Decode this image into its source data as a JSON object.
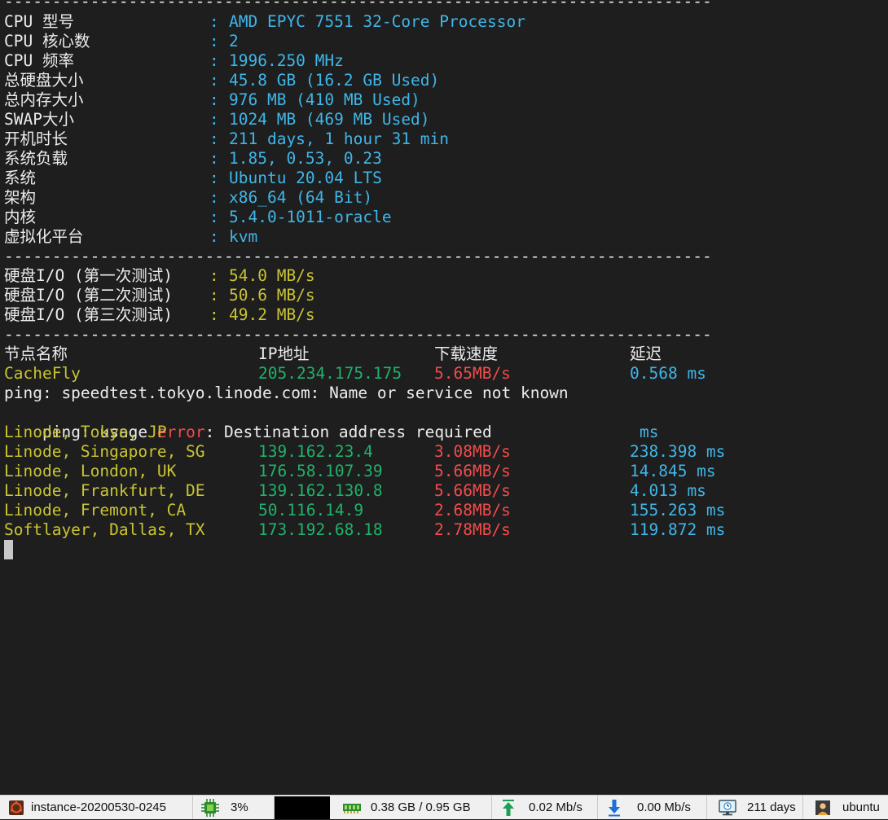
{
  "separator": "--------------------------------------------------------------------------",
  "sysinfo": [
    {
      "label": "CPU 型号",
      "value": "AMD EPYC 7551 32-Core Processor"
    },
    {
      "label": "CPU 核心数",
      "value": "2"
    },
    {
      "label": "CPU 频率",
      "value": "1996.250 MHz"
    },
    {
      "label": "总硬盘大小",
      "value": "45.8 GB (16.2 GB Used)"
    },
    {
      "label": "总内存大小",
      "value": "976 MB (410 MB Used)"
    },
    {
      "label": "SWAP大小",
      "value": "1024 MB (469 MB Used)"
    },
    {
      "label": "开机时长",
      "value": "211 days, 1 hour 31 min"
    },
    {
      "label": "系统负载",
      "value": "1.85, 0.53, 0.23"
    },
    {
      "label": "系统",
      "value": "Ubuntu 20.04 LTS"
    },
    {
      "label": "架构",
      "value": "x86_64 (64 Bit)"
    },
    {
      "label": "内核",
      "value": "5.4.0-1011-oracle"
    },
    {
      "label": "虚拟化平台",
      "value": "kvm"
    }
  ],
  "colon": ":",
  "disk_io": [
    {
      "label": "硬盘I/O (第一次测试)",
      "value": "54.0 MB/s"
    },
    {
      "label": "硬盘I/O (第二次测试)",
      "value": "50.6 MB/s"
    },
    {
      "label": "硬盘I/O (第三次测试)",
      "value": "49.2 MB/s"
    }
  ],
  "speed_header": {
    "node": "节点名称",
    "ip": "IP地址",
    "speed": "下载速度",
    "latency": "延迟"
  },
  "speed_rows_1": [
    {
      "node": "CacheFly",
      "ip": "205.234.175.175",
      "speed": "5.65MB/s",
      "latency": "0.568 ms"
    }
  ],
  "ping_error_1": "ping: speedtest.tokyo.linode.com: Name or service not known",
  "ping_error_2": {
    "prefix": "ping: usage ",
    "error": "error",
    "suffix": ": Destination address required"
  },
  "tokyo_row": {
    "node": "Linode, Tokyo, JP",
    "latency": "ms"
  },
  "speed_rows_2": [
    {
      "node": "Linode, Singapore, SG",
      "ip": "139.162.23.4",
      "speed": "3.08MB/s",
      "latency": "238.398 ms"
    },
    {
      "node": "Linode, London, UK",
      "ip": "176.58.107.39",
      "speed": "5.66MB/s",
      "latency": "14.845 ms"
    },
    {
      "node": "Linode, Frankfurt, DE",
      "ip": "139.162.130.8",
      "speed": "5.66MB/s",
      "latency": "4.013 ms"
    },
    {
      "node": "Linode, Fremont, CA",
      "ip": "50.116.14.9",
      "speed": "2.68MB/s",
      "latency": "155.263 ms"
    },
    {
      "node": "Softlayer, Dallas, TX",
      "ip": "173.192.68.18",
      "speed": "2.78MB/s",
      "latency": "119.872 ms"
    }
  ],
  "taskbar": {
    "instance": "instance-20200530-0245",
    "cpu": "3%",
    "memory": "0.38 GB / 0.95 GB",
    "upload": "0.02 Mb/s",
    "download": "0.00 Mb/s",
    "uptime": "211 days",
    "user": "ubuntu"
  },
  "colors": {
    "background": "#1e1e1e",
    "white": "#ececec",
    "cyan": "#3fb6e8",
    "yellow": "#c9c432",
    "green": "#1fb26b",
    "red": "#f14b4b"
  },
  "icons": [
    "ubuntu-icon",
    "cpu-chip-icon",
    "memory-icon",
    "upload-arrow-icon",
    "download-arrow-icon",
    "monitor-icon",
    "user-icon"
  ]
}
